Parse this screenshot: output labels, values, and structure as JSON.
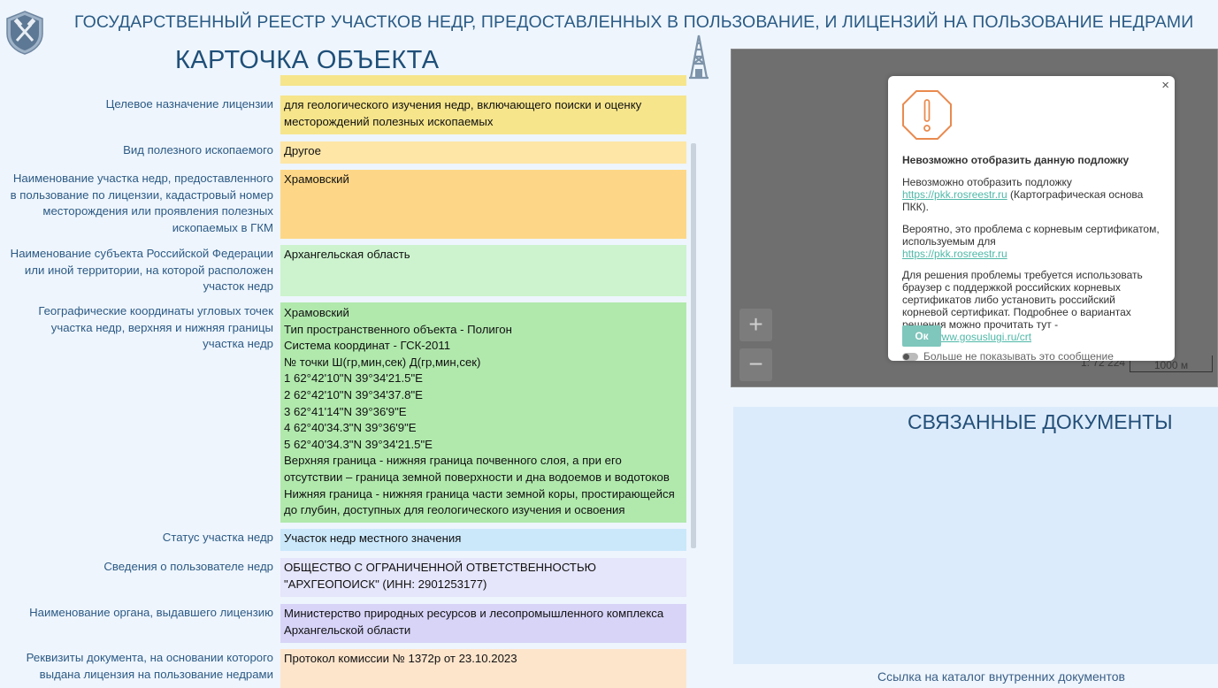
{
  "header": {
    "title": "ГОСУДАРСТВЕННЫЙ РЕЕСТР УЧАСТКОВ НЕДР, ПРЕДОСТАВЛЕННЫХ В ПОЛЬЗОВАНИЕ, И ЛИЦЕНЗИЙ НА ПОЛЬЗОВАНИЕ НЕДРАМИ",
    "logo_icon": "shield-hammers-icon"
  },
  "card": {
    "title": "КАРТОЧКА ОБЪЕКТА",
    "icon": "oil-derrick-icon"
  },
  "fields": [
    {
      "label": "Целевое назначение лицензии",
      "value": [
        "для геологического изучения недр, включающего поиски и оценку",
        "месторождений полезных ископаемых"
      ],
      "color": "#f6e58b"
    },
    {
      "label": "Вид полезного ископаемого",
      "value": [
        "Другое"
      ],
      "color": "#fde6a6"
    },
    {
      "label": "Наименование участка недр, предоставленного в пользование по лицензии, кадастровый номер месторождения или проявления полезных ископаемых в ГКМ",
      "value": [
        "Храмовский"
      ],
      "color": "#fdd787"
    },
    {
      "label": "Наименование субъекта Российской Федерации или иной территории, на которой расположен участок недр",
      "value": [
        "Архангельская область"
      ],
      "color": "#ccf3cd"
    },
    {
      "label": "Географические координаты угловых точек участка недр, верхняя и нижняя границы участка недр",
      "value": [
        "Храмовский",
        "Тип пространственного объекта - Полигон",
        "Система координат - ГСК-2011",
        "№ точки Ш(гр,мин,сек) Д(гр,мин,сек)",
        "1 62°42'10\"N 39°34'21.5\"E",
        "2 62°42'10\"N 39°34'37.8\"E",
        "3 62°41'14\"N 39°36'9\"E",
        "4 62°40'34.3\"N 39°36'9\"E",
        "5 62°40'34.3\"N 39°34'21.5\"E",
        "Верхняя граница - нижняя граница почвенного слоя, а при его",
        "отсутствии – граница земной поверхности и дна водоемов и водотоков",
        "Нижняя граница - нижняя граница части земной коры, простирающейся",
        "до глубин, доступных для геологического изучения и освоения"
      ],
      "color": "#b1e9ad"
    },
    {
      "label": "Статус участка недр",
      "value": [
        "Участок недр местного значения"
      ],
      "color": "#cbe8fb"
    },
    {
      "label": "Сведения о пользователе недр",
      "value": [
        "ОБЩЕСТВО С ОГРАНИЧЕННОЙ ОТВЕТСТВЕННОСТЬЮ",
        "\"АРХГЕОПОИСК\" (ИНН: 2901253177)"
      ],
      "color": "#e5e5fb"
    },
    {
      "label": "Наименование органа, выдавшего лицензию",
      "value": [
        "Министерство природных ресурсов и лесопромышленного комплекса",
        "Архангельской области"
      ],
      "color": "#d7d4f8"
    },
    {
      "label": "Реквизиты документа, на основании которого выдана лицензия на пользование недрами",
      "value": [
        "Протокол комиссии № 1372р от 23.10.2023"
      ],
      "color": "#fde5cc"
    }
  ],
  "map": {
    "zoom_in": "+",
    "zoom_out": "−",
    "scale": "1: 72 224",
    "scale_bar": "1000 м"
  },
  "dialog": {
    "close": "×",
    "icon": "warning-octagon-icon",
    "heading": "Невозможно отобразить данную подложку",
    "p1_text": "Невозможно отобразить подложку",
    "p1_link": "https://pkk.rosreestr.ru",
    "p1_suffix": " (Картографическая основа ПКК).",
    "p2_text": "Вероятно, это проблема с корневым сертификатом, используемым для",
    "p2_link": "https://pkk.rosreestr.ru",
    "p3_text": "Для решения проблемы требуется использовать браузер с поддержкой российских корневых сертификатов либо установить российский корневой сертификат. Подробнее о вариантах решения можно прочитать тут -",
    "p3_link": "https://www.gosuslugi.ru/crt",
    "ok": "Ок",
    "dont_show": "Больше не показывать это сообщение"
  },
  "related_docs": {
    "title": "СВЯЗАННЫЕ ДОКУМЕНТЫ"
  },
  "footer": {
    "link": "Ссылка на каталог внутренних документов"
  }
}
